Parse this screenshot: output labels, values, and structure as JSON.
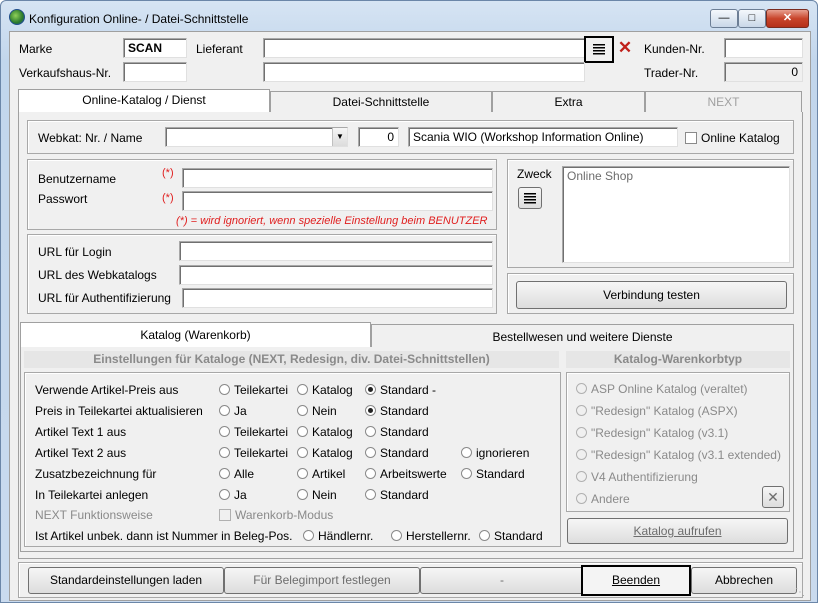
{
  "window": {
    "title": "Konfiguration Online- / Datei-Schnittstelle"
  },
  "header": {
    "marke_label": "Marke",
    "marke_value": "SCAN",
    "lieferant_label": "Lieferant",
    "lieferant_value": "",
    "kunden_label": "Kunden-Nr.",
    "kunden_value": "",
    "verkaufshaus_label": "Verkaufshaus-Nr.",
    "verkaufshaus_value": "",
    "trader_label": "Trader-Nr.",
    "trader_value": "0"
  },
  "tabs": [
    {
      "label": "Online-Katalog / Dienst"
    },
    {
      "label": "Datei-Schnittstelle"
    },
    {
      "label": "Extra"
    },
    {
      "label": "NEXT"
    }
  ],
  "webkat": {
    "label": "Webkat: Nr. / Name",
    "number": "0",
    "name": "Scania WIO (Workshop Information Online)",
    "online_katalog_label": "Online Katalog"
  },
  "login": {
    "user_label": "Benutzername",
    "pass_label": "Passwort",
    "required_mark": "(*)",
    "note": "(*) = wird ignoriert, wenn spezielle Einstellung beim BENUTZER"
  },
  "zweck": {
    "label": "Zweck",
    "value": "Online Shop"
  },
  "urls": {
    "login_label": "URL für Login",
    "webkatalog_label": "URL des Webkatalogs",
    "auth_label": "URL für Authentifizierung"
  },
  "test_button": "Verbindung testen",
  "subtabs": [
    {
      "label": "Katalog (Warenkorb)"
    },
    {
      "label": "Bestellwesen und weitere Dienste"
    }
  ],
  "settings": {
    "heading": "Einstellungen für Kataloge (NEXT, Redesign, div. Datei-Schnittstellen)",
    "rows": [
      {
        "label": "Verwende Artikel-Preis aus",
        "options": [
          "Teilekartei",
          "Katalog",
          "Standard -"
        ]
      },
      {
        "label": "Preis in Teilekartei aktualisieren",
        "options": [
          "Ja",
          "Nein",
          "Standard"
        ]
      },
      {
        "label": "Artikel Text 1 aus",
        "options": [
          "Teilekartei",
          "Katalog",
          "Standard"
        ]
      },
      {
        "label": "Artikel Text 2 aus",
        "options": [
          "Teilekartei",
          "Katalog",
          "Standard",
          "ignorieren"
        ]
      },
      {
        "label": "Zusatzbezeichnung für",
        "options": [
          "Alle",
          "Artikel",
          "Arbeitswerte",
          "Standard"
        ]
      },
      {
        "label": "In Teilekartei anlegen",
        "options": [
          "Ja",
          "Nein",
          "Standard"
        ]
      }
    ],
    "next_label": "NEXT Funktionsweise",
    "warenkorb_modus": "Warenkorb-Modus",
    "unbek_label": "Ist Artikel unbek. dann ist Nummer in Beleg-Pos.",
    "unbek_options": [
      "Händlernr.",
      "Herstellernr.",
      "Standard"
    ]
  },
  "katalogtyp": {
    "heading": "Katalog-Warenkorbtyp",
    "options": [
      "ASP Online Katalog (veraltet)",
      "\"Redesign\" Katalog (ASPX)",
      "\"Redesign\" Katalog (v3.1)",
      "\"Redesign\" Katalog (v3.1 extended)",
      "V4 Authentifizierung",
      "Andere"
    ],
    "call_button": "Katalog aufrufen"
  },
  "footer": {
    "defaults_button": "Standardeinstellungen laden",
    "belegimport_button": "Für Belegimport festlegen",
    "dash_button": "-",
    "finish_button": "Beenden",
    "cancel_button": "Abbrechen"
  },
  "colors": {
    "required": "#e02020",
    "close": "#c8452b"
  }
}
